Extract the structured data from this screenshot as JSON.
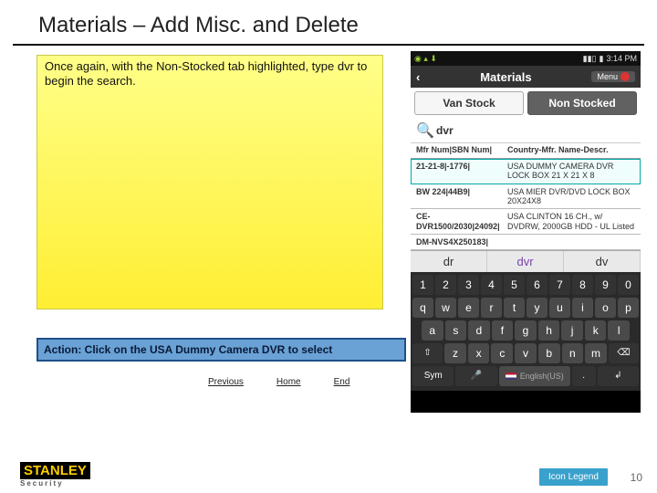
{
  "slide": {
    "title": "Materials – Add Misc. and Delete",
    "note": "Once again, with the Non-Stocked tab highlighted, type dvr to begin the search.",
    "action": "Action:  Click on the USA Dummy Camera DVR to select",
    "page_num": "10"
  },
  "nav": {
    "prev": "Previous",
    "home": "Home",
    "end": "End",
    "legend": "Icon Legend"
  },
  "logo": {
    "name": "STANLEY",
    "sub": "Security"
  },
  "phone": {
    "status_time": "3:14 PM",
    "title": "Materials",
    "menu_label": "Menu",
    "tabs": {
      "van": "Van Stock",
      "nonstock": "Non Stocked"
    },
    "search_value": "dvr",
    "list_header": {
      "left": "Mfr Num|SBN Num|",
      "right": "Country-Mfr. Name-Descr."
    },
    "rows": [
      {
        "left": "21-21-8|-1776|",
        "right": "USA DUMMY CAMERA DVR LOCK BOX 21 X 21 X 8"
      },
      {
        "left": "BW 224|44B9|",
        "right": "USA MIER DVR/DVD LOCK BOX 20X24X8"
      },
      {
        "left": "CE-DVR1500/2030|24092|",
        "right": "USA CLINTON 16 CH., w/ DVDRW, 2000GB HDD - UL Listed"
      },
      {
        "left": "DM-NVS4X250183|",
        "right": ""
      }
    ],
    "suggestions": [
      "dr",
      "dvr",
      "dv"
    ],
    "space_label": "English(US)",
    "keys": {
      "nums": [
        "1",
        "2",
        "3",
        "4",
        "5",
        "6",
        "7",
        "8",
        "9",
        "0"
      ],
      "r1": [
        "q",
        "w",
        "e",
        "r",
        "t",
        "y",
        "u",
        "i",
        "o",
        "p"
      ],
      "r2": [
        "a",
        "s",
        "d",
        "f",
        "g",
        "h",
        "j",
        "k",
        "l"
      ],
      "r3": [
        "z",
        "x",
        "c",
        "v",
        "b",
        "n",
        "m"
      ],
      "shift": "⇧",
      "bksp": "⌫",
      "sym": "Sym",
      "mic": "🎤",
      "enter": "↲"
    }
  }
}
